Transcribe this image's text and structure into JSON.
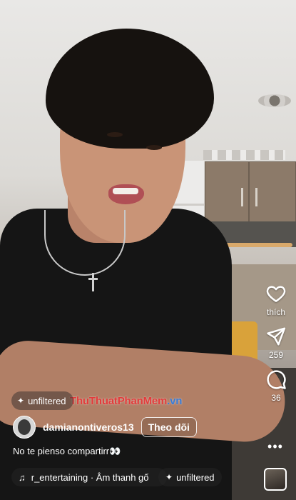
{
  "post": {
    "top_tag": "unfiltered",
    "username": "damianontiveros13",
    "follow_label": "Theo dõi",
    "caption": "No te pienso compartirr👀",
    "audio_text": "r_entertaining · Âm thanh gố",
    "bottom_tag": "unfiltered"
  },
  "actions": {
    "like_label": "thích",
    "share_count": "259",
    "comment_count": "36",
    "more_symbol": "•••"
  },
  "watermark": {
    "main": "ThuThuat",
    "mid": "PhanMem",
    "tail": ".vn"
  },
  "icons": {
    "like": "heart-icon",
    "share": "send-icon",
    "comment": "comment-bubble-icon",
    "more": "more-horizontal-icon",
    "music": "music-note-icon",
    "sparkle": "sparkle-icon"
  }
}
